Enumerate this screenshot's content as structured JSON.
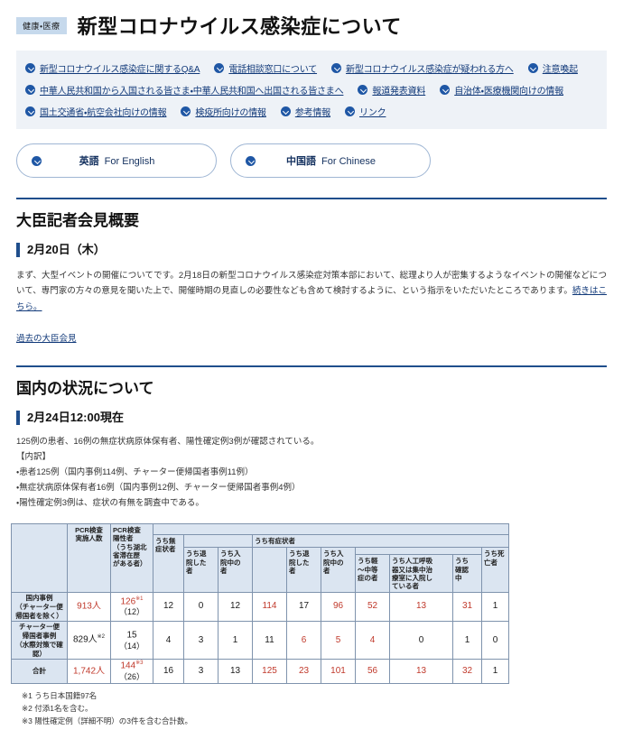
{
  "header": {
    "category_badge": "健康・医療",
    "title": "新型コロナウイルス感染症について"
  },
  "link_panel": {
    "rows": [
      [
        "新型コロナウイルス感染症に関するQ&A",
        "電話相談窓口について",
        "新型コロナウイルス感染症が疑われる方へ",
        "注意喚起"
      ],
      [
        "中華人民共和国から入国される皆さま・中華人民共和国へ出国される皆さまへ",
        "報道発表資料",
        "自治体・医療機関向けの情報"
      ],
      [
        "国土交通省・航空会社向けの情報",
        "検疫所向けの情報",
        "参考情報",
        "リンク"
      ]
    ]
  },
  "language_buttons": [
    {
      "jp": "英語",
      "en": "For English"
    },
    {
      "jp": "中国語",
      "en": "For Chinese"
    }
  ],
  "minister_section": {
    "heading": "大臣記者会見概要",
    "date_heading": "2月20日（木）",
    "body_part1": "まず、大型イベントの開催についてです。2月18日の新型コロナウイルス感染症対策本部において、総理より人が密集するようなイベントの開催などについて、専門家の方々の意見を聞いた上で、開催時期の見直しの必要性なども含めて検討するように、という指示をいただいたところであります。",
    "body_link": "続きはこちら。",
    "past_link": "過去の大臣会見"
  },
  "domestic_section": {
    "heading": "国内の状況について",
    "date_heading": "2月24日12:00現在",
    "summary_lines": [
      "125例の患者、16例の無症状病原体保有者、陽性確定例3例が確認されている。",
      "【内訳】",
      "・患者125例（国内事例114例、チャーター便帰国者事例11例）",
      "・無症状病原体保有者16例（国内事例12例、チャーター便帰国者事例4例）",
      "・陽性確定例3例は、症状の有無を調査中である。"
    ]
  },
  "table": {
    "headers": {
      "pcr_tested": "PCR検査\n実施人数",
      "pcr_positive": "PCR検査\n陽性者\n（うち湖北\n省滞在歴\nがある者）",
      "asymptomatic_group": "うち無\n症状者",
      "asym_discharged": "うち退\n院した\n者",
      "asym_hospitalized": "うち入\n院中の\n者",
      "symptomatic_group": "うち有症状者",
      "sym_discharged": "うち退\n院した\n者",
      "sym_hospitalized": "うち入\n院中の\n者",
      "sym_mild": "うち軽\n～中等\n症の者",
      "sym_severe": "うち人工呼吸\n器又は集中治\n療室に入院し\nている者",
      "sym_checking": "うち\n確認\n中",
      "deceased": "うち死\n亡者"
    },
    "rows": [
      {
        "label": "国内事例\n（チャーター便\n帰国者を除く）",
        "pcr_tested": "913人",
        "pcr_tested_color": "red",
        "pcr_tested_note": "",
        "pcr_positive": "126",
        "pcr_positive_note": "※1",
        "pcr_positive_sub": "（12）",
        "pcr_positive_color": "red",
        "cells": [
          {
            "v": "12",
            "c": "black"
          },
          {
            "v": "0",
            "c": "black"
          },
          {
            "v": "12",
            "c": "black"
          },
          {
            "v": "114",
            "c": "red"
          },
          {
            "v": "17",
            "c": "black"
          },
          {
            "v": "96",
            "c": "red"
          },
          {
            "v": "52",
            "c": "red"
          },
          {
            "v": "13",
            "c": "red"
          },
          {
            "v": "31",
            "c": "red"
          },
          {
            "v": "1",
            "c": "black"
          }
        ]
      },
      {
        "label": "チャーター便\n帰国者事例\n（水際対策で確\n認）",
        "pcr_tested": "829人",
        "pcr_tested_color": "black",
        "pcr_tested_note": "※2",
        "pcr_positive": "15",
        "pcr_positive_note": "",
        "pcr_positive_sub": "（14）",
        "pcr_positive_color": "black",
        "cells": [
          {
            "v": "4",
            "c": "black"
          },
          {
            "v": "3",
            "c": "black"
          },
          {
            "v": "1",
            "c": "black"
          },
          {
            "v": "11",
            "c": "black"
          },
          {
            "v": "6",
            "c": "red"
          },
          {
            "v": "5",
            "c": "red"
          },
          {
            "v": "4",
            "c": "red"
          },
          {
            "v": "0",
            "c": "black"
          },
          {
            "v": "1",
            "c": "black"
          },
          {
            "v": "0",
            "c": "black"
          }
        ]
      },
      {
        "label": "合計",
        "pcr_tested": "1,742人",
        "pcr_tested_color": "red",
        "pcr_tested_note": "",
        "pcr_positive": "144",
        "pcr_positive_note": "※3",
        "pcr_positive_sub": "（26）",
        "pcr_positive_color": "red",
        "cells": [
          {
            "v": "16",
            "c": "black"
          },
          {
            "v": "3",
            "c": "black"
          },
          {
            "v": "13",
            "c": "black"
          },
          {
            "v": "125",
            "c": "red"
          },
          {
            "v": "23",
            "c": "red"
          },
          {
            "v": "101",
            "c": "red"
          },
          {
            "v": "56",
            "c": "red"
          },
          {
            "v": "13",
            "c": "red"
          },
          {
            "v": "32",
            "c": "red"
          },
          {
            "v": "1",
            "c": "black"
          }
        ]
      }
    ],
    "notes": [
      "※1 うち日本国籍97名",
      "※2 付添1名を含む。",
      "※3 陽性確定例（詳細不明）の3件を含む合計数。"
    ]
  },
  "colors": {
    "accent": "#1f4e8c",
    "link": "#123a7a",
    "red_value": "#c0392b",
    "panel_bg": "#eef2f7",
    "table_header_bg": "#dbe5f1"
  }
}
